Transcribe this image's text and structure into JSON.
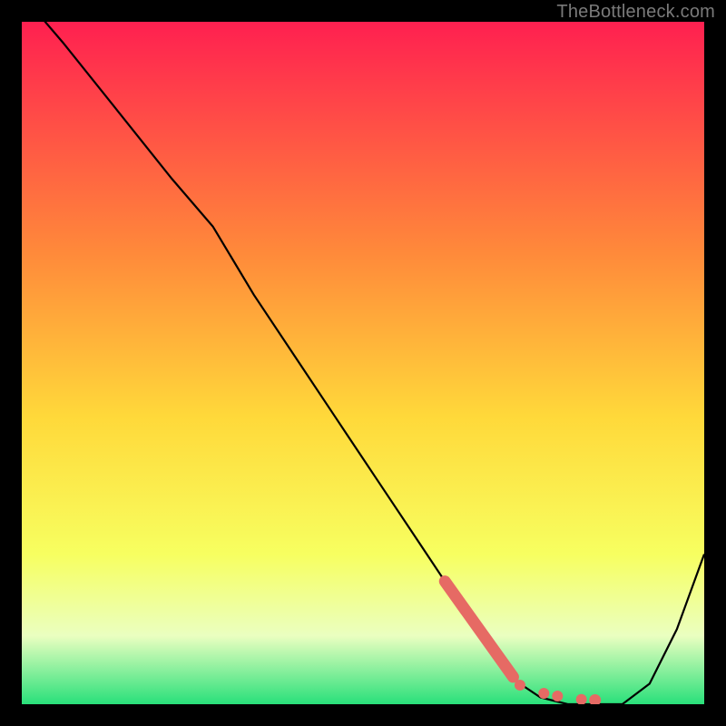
{
  "watermark": "TheBottleneck.com",
  "colors": {
    "bg": "#000000",
    "watermark": "#7a7a7a",
    "gradient_top": "#ff2050",
    "gradient_mid_upper": "#ff8a3a",
    "gradient_mid": "#ffd93a",
    "gradient_lower": "#f7ff60",
    "gradient_pale": "#eaffc0",
    "gradient_bottom": "#29e07a",
    "curve": "#000000",
    "marker": "#e66a64"
  },
  "chart_data": {
    "type": "line",
    "title": "",
    "xlabel": "",
    "ylabel": "",
    "x_range": [
      0,
      100
    ],
    "y_range": [
      0,
      100
    ],
    "grid": false,
    "legend": false,
    "series": [
      {
        "name": "curve",
        "x": [
          0,
          6,
          14,
          22,
          28,
          34,
          40,
          46,
          52,
          58,
          64,
          70,
          73,
          76,
          80,
          84,
          88,
          92,
          96,
          100
        ],
        "y": [
          104,
          97,
          87,
          77,
          70,
          60,
          51,
          42,
          33,
          24,
          15,
          6,
          3,
          1,
          0,
          0,
          0,
          3,
          11,
          22
        ]
      }
    ],
    "markers": {
      "thick_segment": {
        "x": [
          62,
          72
        ],
        "y": [
          18,
          4
        ]
      },
      "dots": [
        {
          "x": 73,
          "y": 2.8
        },
        {
          "x": 76.5,
          "y": 1.6
        },
        {
          "x": 78.5,
          "y": 1.2
        },
        {
          "x": 82,
          "y": 0.7
        },
        {
          "x": 84,
          "y": 0.6
        }
      ]
    }
  }
}
